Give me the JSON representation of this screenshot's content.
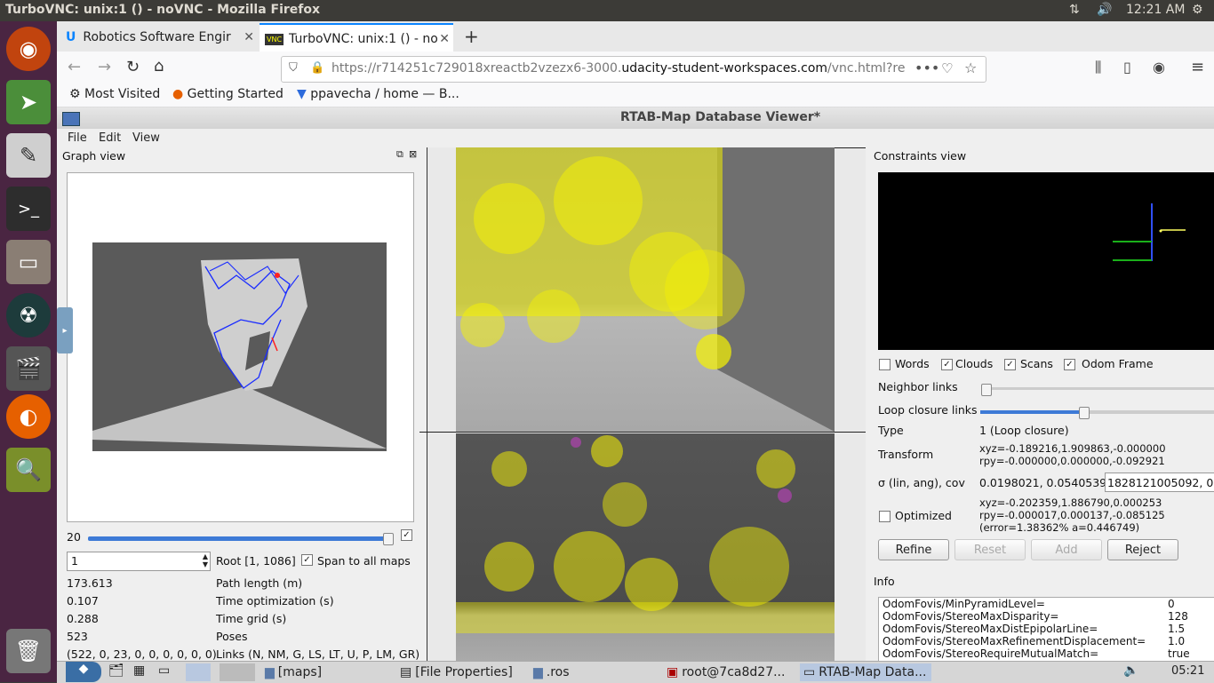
{
  "topbar": {
    "title": "TurboVNC: unix:1 () - noVNC - Mozilla Firefox",
    "time": "12:21 AM"
  },
  "launcher": {
    "items": [
      "ubuntu-icon",
      "compass-icon",
      "text-editor-icon",
      "terminal-icon",
      "file-manager-icon",
      "gitkraken-icon",
      "video-icon",
      "firefox-icon",
      "search-app-icon",
      "trash-icon"
    ]
  },
  "browser": {
    "tabs": [
      {
        "label": "Robotics Software Engir"
      },
      {
        "label": "TurboVNC: unix:1 () - no"
      }
    ],
    "url_prefix": "https://r714251c729018xreactb2vzezx6-3000.",
    "url_domain": "udacity-student-workspaces.com",
    "url_suffix": "/vnc.html?re",
    "bookmarks": [
      "Most Visited",
      "Getting Started",
      "ppavecha / home — B..."
    ]
  },
  "app": {
    "title": "RTAB-Map Database Viewer*",
    "menus": [
      "File",
      "Edit",
      "View"
    ],
    "graph": {
      "panel_title": "Graph view",
      "slider_value": "20",
      "spin_value": "1",
      "root_label": "Root [1, 1086]",
      "span_label": "Span to all maps",
      "stats": [
        {
          "value": "173.613",
          "label": "Path length (m)"
        },
        {
          "value": "0.107",
          "label": "Time optimization (s)"
        },
        {
          "value": "0.288",
          "label": "Time grid (s)"
        },
        {
          "value": "523",
          "label": "Poses"
        },
        {
          "value": "(522, 0, 23, 0, 0, 0, 0, 0, 0)",
          "label": "Links (N, NM, G, LS, LT, U, P, LM, GR)"
        }
      ]
    },
    "constraints": {
      "panel_title": "Constraints view",
      "checks": [
        {
          "label": "Words",
          "checked": false
        },
        {
          "label": "Clouds",
          "checked": true
        },
        {
          "label": "Scans",
          "checked": true
        },
        {
          "label": "Odom Frame",
          "checked": true
        }
      ],
      "neighbor_links": "Neighbor links",
      "loop_links": "Loop closure links",
      "type_label": "Type",
      "type_value": "1  (Loop closure)",
      "transform_label": "Transform",
      "transform_xyz": "xyz=-0.189216,1.909863,-0.000000",
      "transform_rpy": "rpy=-0.000000,0.000000,-0.092921",
      "sigma_label": "σ (lin, ang), cov",
      "sigma_value": "0.0198021, 0.0540539",
      "cov_value": "1828121005092, 0;",
      "optimized_label": "Optimized",
      "opt_xyz": "xyz=-0.202359,1.886790,0.000253",
      "opt_rpy": "rpy=-0.000017,0.000137,-0.085125",
      "opt_error": "(error=1.38362% a=0.446749)",
      "buttons": {
        "refine": "Refine",
        "reset": "Reset",
        "add": "Add",
        "reject": "Reject"
      }
    },
    "info": {
      "title": "Info",
      "rows": [
        {
          "k": "OdomFovis/MinPyramidLevel=",
          "v": "0"
        },
        {
          "k": "OdomFovis/StereoMaxDisparity=",
          "v": "128"
        },
        {
          "k": "OdomFovis/StereoMaxDistEpipolarLine=",
          "v": "1.5"
        },
        {
          "k": "OdomFovis/StereoMaxRefinementDisplacement=",
          "v": "1.0"
        },
        {
          "k": "OdomFovis/StereoRequireMutualMatch=",
          "v": "true"
        }
      ]
    }
  },
  "taskbar": {
    "items": [
      "[maps]",
      "[File Properties]",
      ".ros",
      "root@7ca8d27...",
      "RTAB-Map Data..."
    ],
    "clock": "05:21"
  }
}
